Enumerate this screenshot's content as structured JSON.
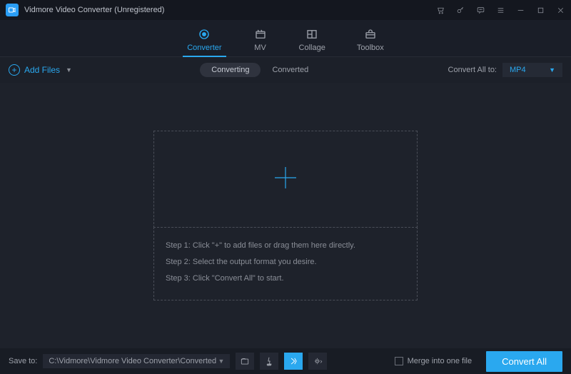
{
  "titlebar": {
    "title": "Vidmore Video Converter (Unregistered)"
  },
  "tabs": {
    "converter": "Converter",
    "mv": "MV",
    "collage": "Collage",
    "toolbox": "Toolbox"
  },
  "secbar": {
    "add_files": "Add Files",
    "converting": "Converting",
    "converted": "Converted",
    "convert_all_to": "Convert All to:",
    "format": "MP4"
  },
  "steps": {
    "s1": "Step 1: Click \"+\" to add files or drag them here directly.",
    "s2": "Step 2: Select the output format you desire.",
    "s3": "Step 3: Click \"Convert All\" to start."
  },
  "bottom": {
    "save_to": "Save to:",
    "path": "C:\\Vidmore\\Vidmore Video Converter\\Converted",
    "merge": "Merge into one file",
    "convert_all": "Convert All"
  }
}
